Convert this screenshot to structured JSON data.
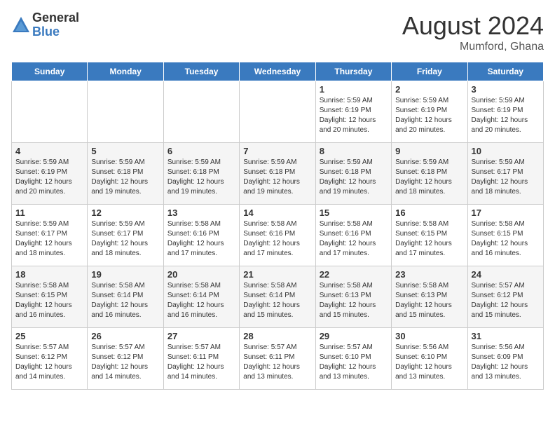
{
  "logo": {
    "general": "General",
    "blue": "Blue"
  },
  "title": "August 2024",
  "location": "Mumford, Ghana",
  "weekdays": [
    "Sunday",
    "Monday",
    "Tuesday",
    "Wednesday",
    "Thursday",
    "Friday",
    "Saturday"
  ],
  "weeks": [
    [
      {
        "day": "",
        "info": ""
      },
      {
        "day": "",
        "info": ""
      },
      {
        "day": "",
        "info": ""
      },
      {
        "day": "",
        "info": ""
      },
      {
        "day": "1",
        "info": "Sunrise: 5:59 AM\nSunset: 6:19 PM\nDaylight: 12 hours\nand 20 minutes."
      },
      {
        "day": "2",
        "info": "Sunrise: 5:59 AM\nSunset: 6:19 PM\nDaylight: 12 hours\nand 20 minutes."
      },
      {
        "day": "3",
        "info": "Sunrise: 5:59 AM\nSunset: 6:19 PM\nDaylight: 12 hours\nand 20 minutes."
      }
    ],
    [
      {
        "day": "4",
        "info": "Sunrise: 5:59 AM\nSunset: 6:19 PM\nDaylight: 12 hours\nand 20 minutes."
      },
      {
        "day": "5",
        "info": "Sunrise: 5:59 AM\nSunset: 6:18 PM\nDaylight: 12 hours\nand 19 minutes."
      },
      {
        "day": "6",
        "info": "Sunrise: 5:59 AM\nSunset: 6:18 PM\nDaylight: 12 hours\nand 19 minutes."
      },
      {
        "day": "7",
        "info": "Sunrise: 5:59 AM\nSunset: 6:18 PM\nDaylight: 12 hours\nand 19 minutes."
      },
      {
        "day": "8",
        "info": "Sunrise: 5:59 AM\nSunset: 6:18 PM\nDaylight: 12 hours\nand 19 minutes."
      },
      {
        "day": "9",
        "info": "Sunrise: 5:59 AM\nSunset: 6:18 PM\nDaylight: 12 hours\nand 18 minutes."
      },
      {
        "day": "10",
        "info": "Sunrise: 5:59 AM\nSunset: 6:17 PM\nDaylight: 12 hours\nand 18 minutes."
      }
    ],
    [
      {
        "day": "11",
        "info": "Sunrise: 5:59 AM\nSunset: 6:17 PM\nDaylight: 12 hours\nand 18 minutes."
      },
      {
        "day": "12",
        "info": "Sunrise: 5:59 AM\nSunset: 6:17 PM\nDaylight: 12 hours\nand 18 minutes."
      },
      {
        "day": "13",
        "info": "Sunrise: 5:58 AM\nSunset: 6:16 PM\nDaylight: 12 hours\nand 17 minutes."
      },
      {
        "day": "14",
        "info": "Sunrise: 5:58 AM\nSunset: 6:16 PM\nDaylight: 12 hours\nand 17 minutes."
      },
      {
        "day": "15",
        "info": "Sunrise: 5:58 AM\nSunset: 6:16 PM\nDaylight: 12 hours\nand 17 minutes."
      },
      {
        "day": "16",
        "info": "Sunrise: 5:58 AM\nSunset: 6:15 PM\nDaylight: 12 hours\nand 17 minutes."
      },
      {
        "day": "17",
        "info": "Sunrise: 5:58 AM\nSunset: 6:15 PM\nDaylight: 12 hours\nand 16 minutes."
      }
    ],
    [
      {
        "day": "18",
        "info": "Sunrise: 5:58 AM\nSunset: 6:15 PM\nDaylight: 12 hours\nand 16 minutes."
      },
      {
        "day": "19",
        "info": "Sunrise: 5:58 AM\nSunset: 6:14 PM\nDaylight: 12 hours\nand 16 minutes."
      },
      {
        "day": "20",
        "info": "Sunrise: 5:58 AM\nSunset: 6:14 PM\nDaylight: 12 hours\nand 16 minutes."
      },
      {
        "day": "21",
        "info": "Sunrise: 5:58 AM\nSunset: 6:14 PM\nDaylight: 12 hours\nand 15 minutes."
      },
      {
        "day": "22",
        "info": "Sunrise: 5:58 AM\nSunset: 6:13 PM\nDaylight: 12 hours\nand 15 minutes."
      },
      {
        "day": "23",
        "info": "Sunrise: 5:58 AM\nSunset: 6:13 PM\nDaylight: 12 hours\nand 15 minutes."
      },
      {
        "day": "24",
        "info": "Sunrise: 5:57 AM\nSunset: 6:12 PM\nDaylight: 12 hours\nand 15 minutes."
      }
    ],
    [
      {
        "day": "25",
        "info": "Sunrise: 5:57 AM\nSunset: 6:12 PM\nDaylight: 12 hours\nand 14 minutes."
      },
      {
        "day": "26",
        "info": "Sunrise: 5:57 AM\nSunset: 6:12 PM\nDaylight: 12 hours\nand 14 minutes."
      },
      {
        "day": "27",
        "info": "Sunrise: 5:57 AM\nSunset: 6:11 PM\nDaylight: 12 hours\nand 14 minutes."
      },
      {
        "day": "28",
        "info": "Sunrise: 5:57 AM\nSunset: 6:11 PM\nDaylight: 12 hours\nand 13 minutes."
      },
      {
        "day": "29",
        "info": "Sunrise: 5:57 AM\nSunset: 6:10 PM\nDaylight: 12 hours\nand 13 minutes."
      },
      {
        "day": "30",
        "info": "Sunrise: 5:56 AM\nSunset: 6:10 PM\nDaylight: 12 hours\nand 13 minutes."
      },
      {
        "day": "31",
        "info": "Sunrise: 5:56 AM\nSunset: 6:09 PM\nDaylight: 12 hours\nand 13 minutes."
      }
    ]
  ]
}
